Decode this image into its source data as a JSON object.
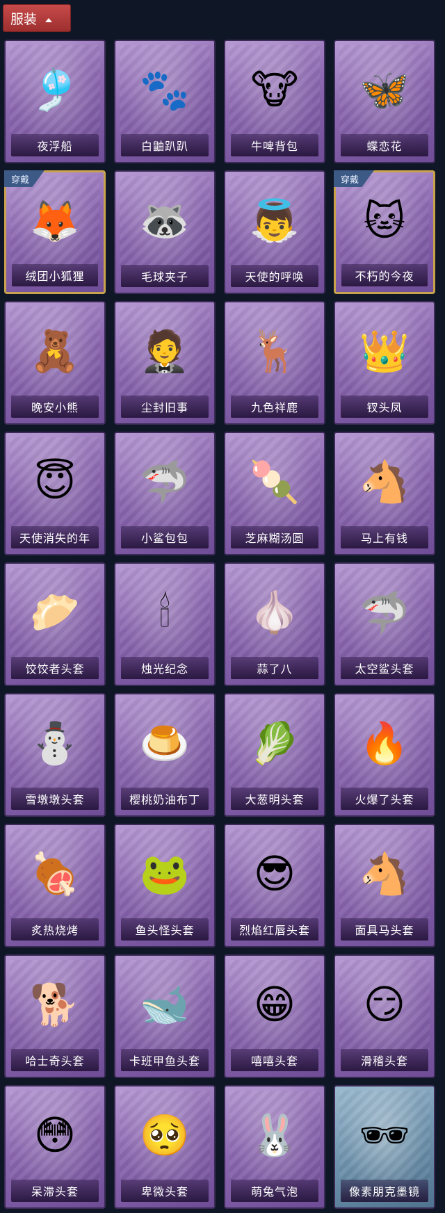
{
  "header": {
    "label": "服装"
  },
  "items": [
    {
      "name": "夜浮船",
      "icon": "jellyfish-icon",
      "glyph": "🎐",
      "worn": false,
      "blue": false
    },
    {
      "name": "白鼬趴趴",
      "icon": "ferret-icon",
      "glyph": "🐾",
      "worn": false,
      "blue": false
    },
    {
      "name": "牛啤背包",
      "icon": "cow-beer-icon",
      "glyph": "🐮",
      "worn": false,
      "blue": false
    },
    {
      "name": "蝶恋花",
      "icon": "butterfly-bell-icon",
      "glyph": "🦋",
      "worn": false,
      "blue": false
    },
    {
      "name": "绒团小狐狸",
      "icon": "fox-icon",
      "glyph": "🦊",
      "worn": true,
      "blue": false
    },
    {
      "name": "毛球夹子",
      "icon": "raccoon-icon",
      "glyph": "🦝",
      "worn": false,
      "blue": false
    },
    {
      "name": "天使的呼唤",
      "icon": "angel-icon",
      "glyph": "👼",
      "worn": false,
      "blue": false
    },
    {
      "name": "不朽的今夜",
      "icon": "pink-cat-icon",
      "glyph": "🐱",
      "worn": true,
      "blue": false
    },
    {
      "name": "晚安小熊",
      "icon": "bear-icon",
      "glyph": "🧸",
      "worn": false,
      "blue": false
    },
    {
      "name": "尘封旧事",
      "icon": "doll-icon",
      "glyph": "🤵",
      "worn": false,
      "blue": false
    },
    {
      "name": "九色祥鹿",
      "icon": "deer-icon",
      "glyph": "🦌",
      "worn": false,
      "blue": false
    },
    {
      "name": "钗头凤",
      "icon": "phoenix-crown-icon",
      "glyph": "👑",
      "worn": false,
      "blue": false
    },
    {
      "name": "天使消失的年",
      "icon": "angel-girl-icon",
      "glyph": "😇",
      "worn": false,
      "blue": false
    },
    {
      "name": "小鲨包包",
      "icon": "shark-bag-icon",
      "glyph": "🦈",
      "worn": false,
      "blue": false
    },
    {
      "name": "芝麻糊汤圆",
      "icon": "dumpling-icon",
      "glyph": "🍡",
      "worn": false,
      "blue": false
    },
    {
      "name": "马上有钱",
      "icon": "horse-icon",
      "glyph": "🐴",
      "worn": false,
      "blue": false
    },
    {
      "name": "饺饺者头套",
      "icon": "dumpling-head-icon",
      "glyph": "🥟",
      "worn": false,
      "blue": false
    },
    {
      "name": "烛光纪念",
      "icon": "candle-icon",
      "glyph": "🕯",
      "worn": false,
      "blue": false
    },
    {
      "name": "蒜了八",
      "icon": "garlic-icon",
      "glyph": "🧄",
      "worn": false,
      "blue": false
    },
    {
      "name": "太空鲨头套",
      "icon": "space-shark-icon",
      "glyph": "🦈",
      "worn": false,
      "blue": false
    },
    {
      "name": "雪墩墩头套",
      "icon": "snowman-icon",
      "glyph": "⛄",
      "worn": false,
      "blue": false
    },
    {
      "name": "樱桃奶油布丁",
      "icon": "pudding-icon",
      "glyph": "🍮",
      "worn": false,
      "blue": false
    },
    {
      "name": "大葱明头套",
      "icon": "scallion-icon",
      "glyph": "🥬",
      "worn": false,
      "blue": false
    },
    {
      "name": "火爆了头套",
      "icon": "fire-icon",
      "glyph": "🔥",
      "worn": false,
      "blue": false
    },
    {
      "name": "炙热烧烤",
      "icon": "bbq-meat-icon",
      "glyph": "🍖",
      "worn": false,
      "blue": false
    },
    {
      "name": "鱼头怪头套",
      "icon": "fish-head-icon",
      "glyph": "🐸",
      "worn": false,
      "blue": false
    },
    {
      "name": "烈焰红唇头套",
      "icon": "yellow-mouse-icon",
      "glyph": "😎",
      "worn": false,
      "blue": false
    },
    {
      "name": "面具马头套",
      "icon": "horse-mask-icon",
      "glyph": "🐴",
      "worn": false,
      "blue": false
    },
    {
      "name": "哈士奇头套",
      "icon": "husky-icon",
      "glyph": "🐕",
      "worn": false,
      "blue": false
    },
    {
      "name": "卡班甲鱼头套",
      "icon": "whale-icon",
      "glyph": "🐋",
      "worn": false,
      "blue": false
    },
    {
      "name": "嘻嘻头套",
      "icon": "grin-emoji-icon",
      "glyph": "😁",
      "worn": false,
      "blue": false
    },
    {
      "name": "滑稽头套",
      "icon": "funny-emoji-icon",
      "glyph": "😏",
      "worn": false,
      "blue": false
    },
    {
      "name": "呆滞头套",
      "icon": "stunned-emoji-icon",
      "glyph": "😳",
      "worn": false,
      "blue": false
    },
    {
      "name": "卑微头套",
      "icon": "humble-emoji-icon",
      "glyph": "🥺",
      "worn": false,
      "blue": false
    },
    {
      "name": "萌兔气泡",
      "icon": "bunny-bubble-icon",
      "glyph": "🐰",
      "worn": false,
      "blue": false
    },
    {
      "name": "像素朋克墨镜",
      "icon": "pixel-sunglasses-icon",
      "glyph": "🕶",
      "worn": false,
      "blue": true
    }
  ],
  "worn_badge_label": "穿戴"
}
